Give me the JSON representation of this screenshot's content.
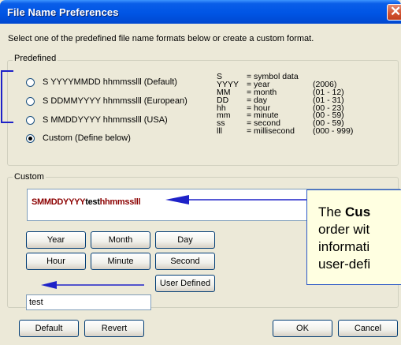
{
  "window": {
    "title": "File Name Preferences",
    "close_glyph": "✕",
    "intro_text": "Select one of the predefined file name formats below or create a custom format."
  },
  "predefined": {
    "group_label": "Predefined",
    "options": [
      {
        "label": "S YYYYMMDD hhmmsslll (Default)",
        "selected": false
      },
      {
        "label": "S DDMMYYYY hhmmsslll (European)",
        "selected": false
      },
      {
        "label": "S MMDDYYYY hhmmsslll (USA)",
        "selected": false
      },
      {
        "label": "Custom (Define below)",
        "selected": true
      }
    ],
    "legend": [
      {
        "code": "S",
        "meaning": "= symbol data",
        "range": ""
      },
      {
        "code": "YYYY",
        "meaning": "= year",
        "range": "(2006)"
      },
      {
        "code": "MM",
        "meaning": "= month",
        "range": "(01 - 12)"
      },
      {
        "code": "DD",
        "meaning": "= day",
        "range": "(01 - 31)"
      },
      {
        "code": "hh",
        "meaning": "= hour",
        "range": "(00 - 23)"
      },
      {
        "code": "mm",
        "meaning": "= minute",
        "range": "(00 - 59)"
      },
      {
        "code": "ss",
        "meaning": "= second",
        "range": "(00 - 59)"
      },
      {
        "code": "lll",
        "meaning": "= millisecond",
        "range": "(000 - 999)"
      }
    ]
  },
  "custom": {
    "group_label": "Custom",
    "format_part1": "SMMDDYYYY",
    "format_part2": "test",
    "format_part3": "hhmmsslll",
    "buttons": {
      "year": "Year",
      "month": "Month",
      "day": "Day",
      "hour": "Hour",
      "minute": "Minute",
      "second": "Second",
      "user_defined": "User Defined"
    },
    "user_text_value": "test"
  },
  "footer": {
    "default": "Default",
    "revert": "Revert",
    "ok": "OK",
    "cancel": "Cancel"
  },
  "callout": {
    "line1_prefix": "The ",
    "line1_bold": "Cus",
    "line2": "order wit",
    "line3": "informati",
    "line4": "user-defi"
  },
  "colors": {
    "titlebar": "#0055E5",
    "annotation_blue": "#1E22C8",
    "format_red": "#8B0000",
    "dialog_bg": "#ECE9D8"
  }
}
